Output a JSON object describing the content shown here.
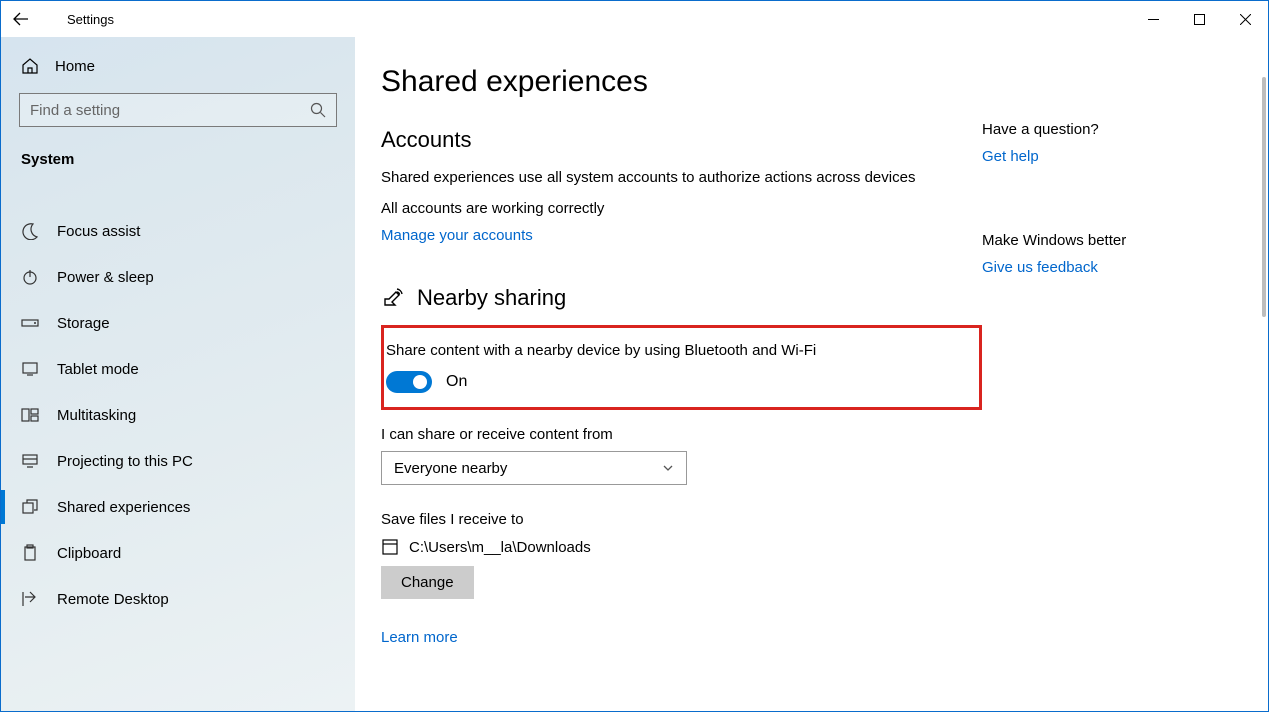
{
  "titlebar": {
    "title": "Settings"
  },
  "sidebar": {
    "home_label": "Home",
    "search_placeholder": "Find a setting",
    "category": "System",
    "items": [
      {
        "label": "Focus assist"
      },
      {
        "label": "Power & sleep"
      },
      {
        "label": "Storage"
      },
      {
        "label": "Tablet mode"
      },
      {
        "label": "Multitasking"
      },
      {
        "label": "Projecting to this PC"
      },
      {
        "label": "Shared experiences"
      },
      {
        "label": "Clipboard"
      },
      {
        "label": "Remote Desktop"
      }
    ]
  },
  "main": {
    "page_title": "Shared experiences",
    "accounts": {
      "heading": "Accounts",
      "description": "Shared experiences use all system accounts to authorize actions across devices",
      "status": "All accounts are working correctly",
      "manage_link": "Manage your accounts"
    },
    "nearby": {
      "heading": "Nearby sharing",
      "share_desc": "Share content with a nearby device by using Bluetooth and Wi-Fi",
      "toggle_label": "On",
      "receive_from_label": "I can share or receive content from",
      "receive_from_value": "Everyone nearby",
      "saveto_label": "Save files I receive to",
      "saveto_path": "C:\\Users\\m__la\\Downloads",
      "change_button": "Change",
      "learn_more": "Learn more"
    }
  },
  "aside": {
    "question_label": "Have a question?",
    "get_help": "Get help",
    "better_label": "Make Windows better",
    "feedback": "Give us feedback"
  }
}
